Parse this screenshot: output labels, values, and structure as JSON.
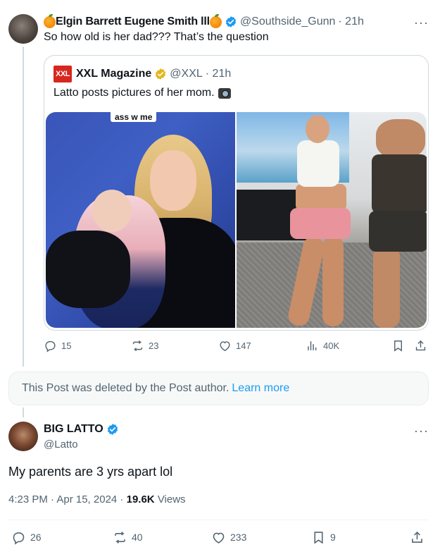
{
  "reply": {
    "name": "Elgin Barrett Eugene Smith lll",
    "handle": "@Southside_Gunn",
    "time": "· 21h",
    "text": "So how old is her dad??? That’s the question",
    "more": "···"
  },
  "quote": {
    "logo": "XXL",
    "name": "XXL Magazine",
    "handle": "@XXL",
    "time": "· 21h",
    "text": "Latto posts pictures of her mom.",
    "photo_caption": "ass w me"
  },
  "reply_actions": {
    "replies": "15",
    "reposts": "23",
    "likes": "147",
    "views": "40K"
  },
  "deleted_notice": {
    "text": "This Post was deleted by the Post author.",
    "link": "Learn more"
  },
  "main": {
    "name": "BIG LATTO",
    "handle": "@Latto",
    "text": "My parents are 3 yrs apart lol",
    "time": "4:23 PM · Apr 15, 2024 ·",
    "views_count": "19.6K",
    "views_label": "Views",
    "more": "···"
  },
  "main_actions": {
    "replies": "26",
    "reposts": "40",
    "likes": "233",
    "bookmarks": "9"
  },
  "colors": {
    "accent": "#1d9bf0",
    "text_secondary": "#536471",
    "verified_gold": "#e2b719"
  },
  "icons": [
    "orange-emoji-icon",
    "verified-badge-icon",
    "gold-verified-icon",
    "camera-icon",
    "reply-icon",
    "repost-icon",
    "like-icon",
    "views-icon",
    "bookmark-icon",
    "share-icon",
    "more-icon"
  ]
}
